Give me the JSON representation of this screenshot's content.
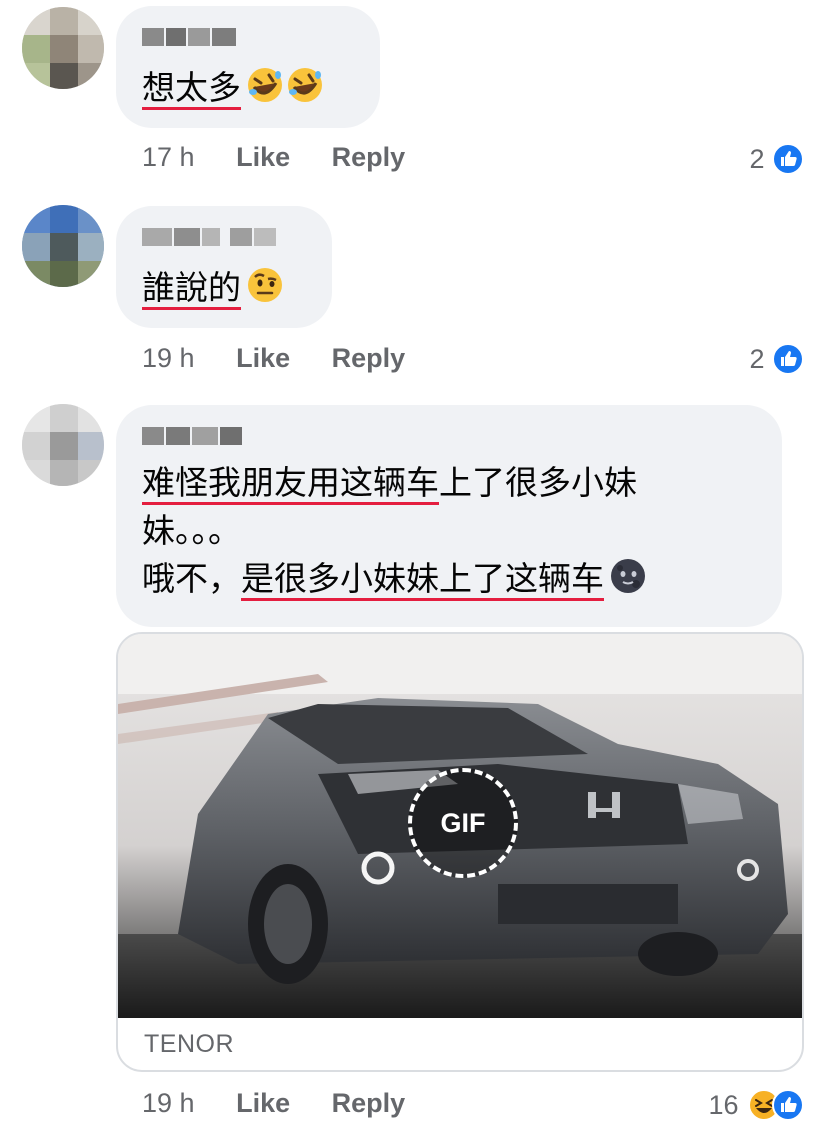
{
  "comments": [
    {
      "author": "",
      "text": "想太多",
      "emoji": "rolling-on-floor-laughing-icon",
      "time": "17 h",
      "like_label": "Like",
      "reply_label": "Reply",
      "reaction_count": "2"
    },
    {
      "author": "",
      "text": "誰說的",
      "emoji": "face-with-raised-eyebrow-icon",
      "time": "19 h",
      "like_label": "Like",
      "reply_label": "Reply",
      "reaction_count": "2"
    },
    {
      "author": "",
      "line1_a": "难怪我朋友用这辆车",
      "line1_b": "上了很多小妹",
      "line2": "妹。。。",
      "line3_a": "哦不，",
      "line3_b": "是很多小妹妹上了这辆车",
      "emoji": "new-moon-face-icon",
      "gif_badge": "GIF",
      "gif_source": "TENOR",
      "time": "19 h",
      "like_label": "Like",
      "reply_label": "Reply",
      "reaction_count": "16"
    }
  ],
  "colors": {
    "bubble": "#f0f2f5",
    "meta_text": "#65676b",
    "like_blue": "#1877f2",
    "underline_red": "#e41e3f",
    "haha_yellow": "#f7b125"
  }
}
